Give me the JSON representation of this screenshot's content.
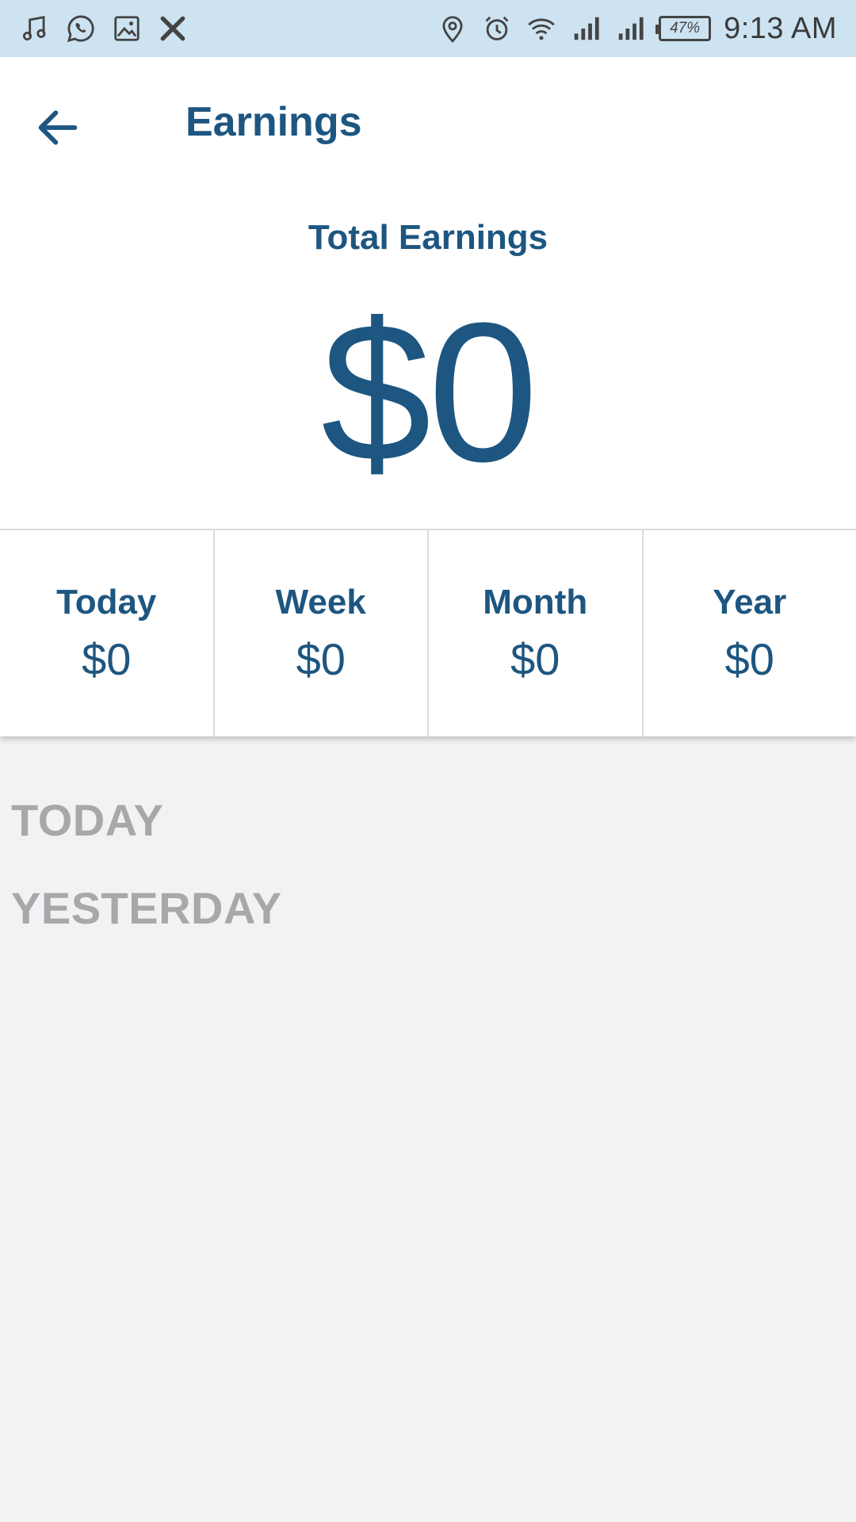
{
  "status_bar": {
    "left_icons": [
      "music-note-icon",
      "whatsapp-icon",
      "image-icon",
      "x-app-icon"
    ],
    "right_icons": [
      "location-pin-icon",
      "alarm-clock-icon",
      "wifi-icon",
      "signal-bars-icon",
      "signal-bars-2-icon"
    ],
    "battery_level": "47%",
    "time": "9:13 AM"
  },
  "header": {
    "title": "Earnings",
    "back_icon": "arrow-left-icon"
  },
  "summary": {
    "total_label": "Total Earnings",
    "total_value": "$0"
  },
  "periods": [
    {
      "label": "Today",
      "value": "$0"
    },
    {
      "label": "Week",
      "value": "$0"
    },
    {
      "label": "Month",
      "value": "$0"
    },
    {
      "label": "Year",
      "value": "$0"
    }
  ],
  "sections": {
    "today": "TODAY",
    "yesterday": "YESTERDAY"
  },
  "colors": {
    "primary": "#1d5680",
    "status_bar_bg": "#cde3f1",
    "section_heading": "#a7a8aa",
    "page_bg": "#f1f2f4"
  }
}
